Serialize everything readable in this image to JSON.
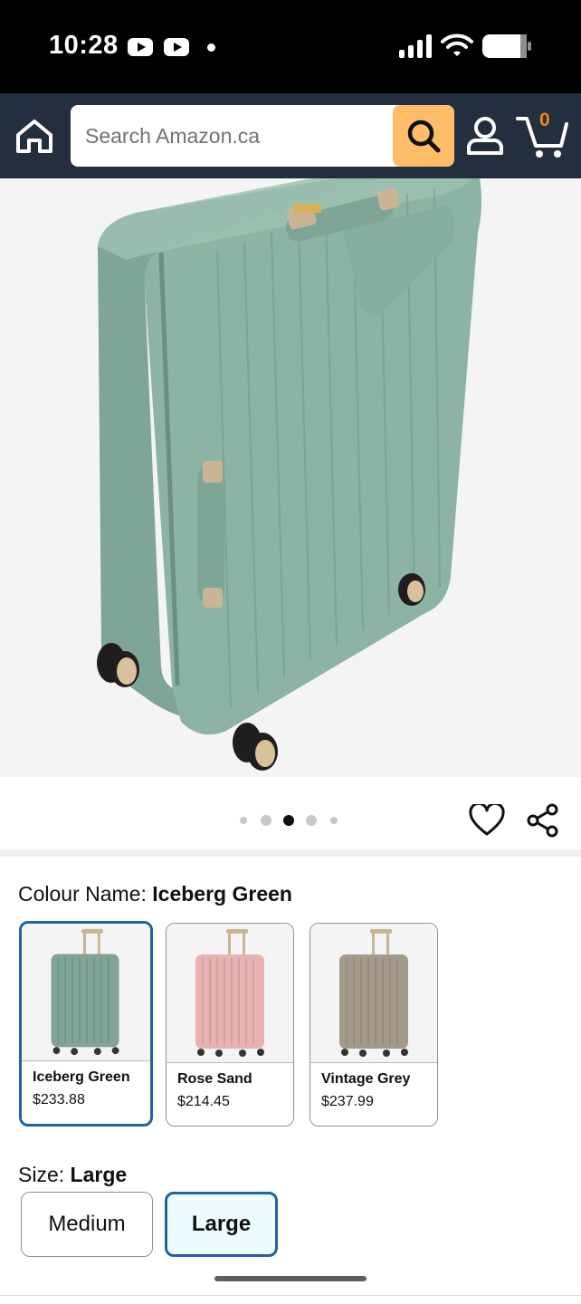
{
  "status_bar": {
    "time": "10:28",
    "icons": [
      "youtube-icon",
      "youtube-icon",
      "dot-icon",
      "signal-icon",
      "wifi-icon",
      "battery-icon"
    ]
  },
  "header": {
    "search_placeholder": "Search Amazon.ca",
    "cart_count": "0",
    "icons": [
      "home-icon",
      "search-icon",
      "account-icon",
      "cart-icon"
    ],
    "colors": {
      "header_bg": "#232f3e",
      "search_button": "#febd69",
      "cart_count": "#f08804"
    }
  },
  "product_image": {
    "carousel_total": 5,
    "carousel_active_index": 2
  },
  "colour": {
    "label": "Colour Name:",
    "selected": "Iceberg Green",
    "options": [
      {
        "name": "Iceberg Green",
        "price": "$233.88",
        "selected": true,
        "color": "#7fa597"
      },
      {
        "name": "Rose Sand",
        "price": "$214.45",
        "selected": false,
        "color": "#e7b3b1"
      },
      {
        "name": "Vintage Grey",
        "price": "$237.99",
        "selected": false,
        "color": "#a49a89"
      }
    ]
  },
  "size": {
    "label": "Size:",
    "selected": "Large",
    "options": [
      {
        "name": "Medium",
        "selected": false
      },
      {
        "name": "Large",
        "selected": true
      }
    ]
  },
  "colors": {
    "selected_border": "#2162a1",
    "selected_bg": "#edfdff"
  }
}
